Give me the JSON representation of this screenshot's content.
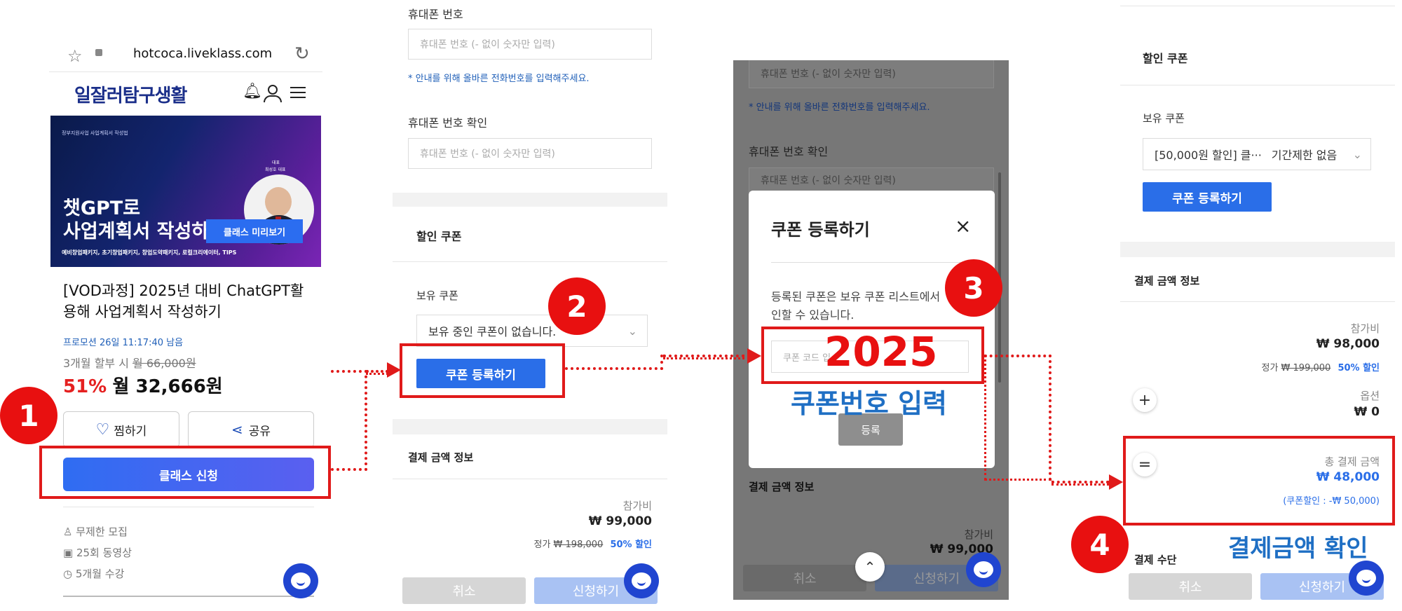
{
  "panel1": {
    "url": "hotcoca.liveklass.com",
    "logo": "일잘러탐구생활",
    "banner": {
      "small_top": "정부지원사업 사업계획서 작성법",
      "headline1": "챗GPT로",
      "headline2": "사업계획서 작성하",
      "preview_button": "클래스 미리보기",
      "ceo_role": "대표",
      "ceo_name": "최성호 대표",
      "footer": "예비창업패키지, 초기창업패키지, 창업도약패키지, 로컬크리에이터, TIPS"
    },
    "title": "[VOD과정] 2025년 대비 ChatGPT활용해 사업계획서 작성하기",
    "promo_timer": "프로모션 26일 11:17:40 남음",
    "installment_label": "3개월 할부 시 ",
    "installment_old": "월 66,000원",
    "discount_pct": "51%",
    "price": "월 32,666원",
    "wish_button": "찜하기",
    "share_button": "공유",
    "apply_button": "클래스 신청",
    "meta": [
      "무제한 모집",
      "25회 동영상",
      "5개월 수강"
    ]
  },
  "panel2": {
    "phone_label": "휴대폰 번호",
    "phone_placeholder": "휴대폰 번호 (- 없이 숫자만 입력)",
    "phone_hint": "* 안내를 위해 올바른 전화번호를 입력해주세요.",
    "phone_confirm_label": "휴대폰 번호 확인",
    "phone_confirm_placeholder": "휴대폰 번호 (- 없이 숫자만 입력)",
    "coupon_section": "할인 쿠폰",
    "owned_coupon_label": "보유 쿠폰",
    "owned_coupon_value": "보유 중인 쿠폰이 없습니다.",
    "register_coupon_button": "쿠폰 등록하기",
    "payment_section": "결제 금액 정보",
    "fee_label": "참가비",
    "fee_value": "₩ 99,000",
    "list_price_label": "정가 ",
    "list_price": "₩ 198,000",
    "discount_label": "50% 할인",
    "cancel_button": "취소",
    "apply_button": "신청하기"
  },
  "panel3": {
    "phone_placeholder": "휴대폰 번호 (- 없이 숫자만 입력)",
    "phone_hint": "* 안내를 위해 올바른 전화번호를 입력해주세요.",
    "phone_confirm_label": "휴대폰 번호 확인",
    "phone_confirm_placeholder": "휴대폰 번호 (- 없이 숫자만 입력)",
    "modal_title": "쿠폰 등록하기",
    "modal_desc1": "등록된 쿠폰은 보유 쿠폰 리스트에서",
    "modal_desc2": "인할 수 있습니다.",
    "coupon_code_placeholder": "쿠폰 코드 입",
    "register_button": "등록",
    "payment_section": "결제 금액 정보",
    "fee_label": "참가비",
    "fee_value": "₩ 99,000",
    "cancel_button": "취소",
    "apply_button": "신청하기"
  },
  "panel4": {
    "coupon_section": "할인 쿠폰",
    "owned_coupon_label": "보유 쿠폰",
    "owned_coupon_value": "[50,000원 할인] 클···",
    "owned_coupon_period": "기간제한 없음",
    "register_coupon_button": "쿠폰 등록하기",
    "payment_section": "결제 금액 정보",
    "fee_label": "참가비",
    "fee_value": "₩ 98,000",
    "list_price_label": "정가 ",
    "list_price": "₩ 199,000",
    "discount_label": "50% 할인",
    "option_label": "옵션",
    "option_value": "₩ 0",
    "total_label": "총 결제 금액",
    "total_value": "₩ 48,000",
    "coupon_discount": "(쿠폰할인 : -₩ 50,000)",
    "pay_method_label": "결제 수단",
    "cancel_button": "취소",
    "apply_button": "신청하기"
  },
  "annotations": {
    "step1": "1",
    "step2": "2",
    "step3": "3",
    "step4": "4",
    "coupon_code": "2025",
    "coupon_caption": "쿠폰번호 입력",
    "total_caption": "결제금액 확인"
  },
  "colors": {
    "accent_red": "#e01a1a",
    "primary_blue": "#2a6ee8",
    "caption_blue": "#1f6fc4"
  }
}
